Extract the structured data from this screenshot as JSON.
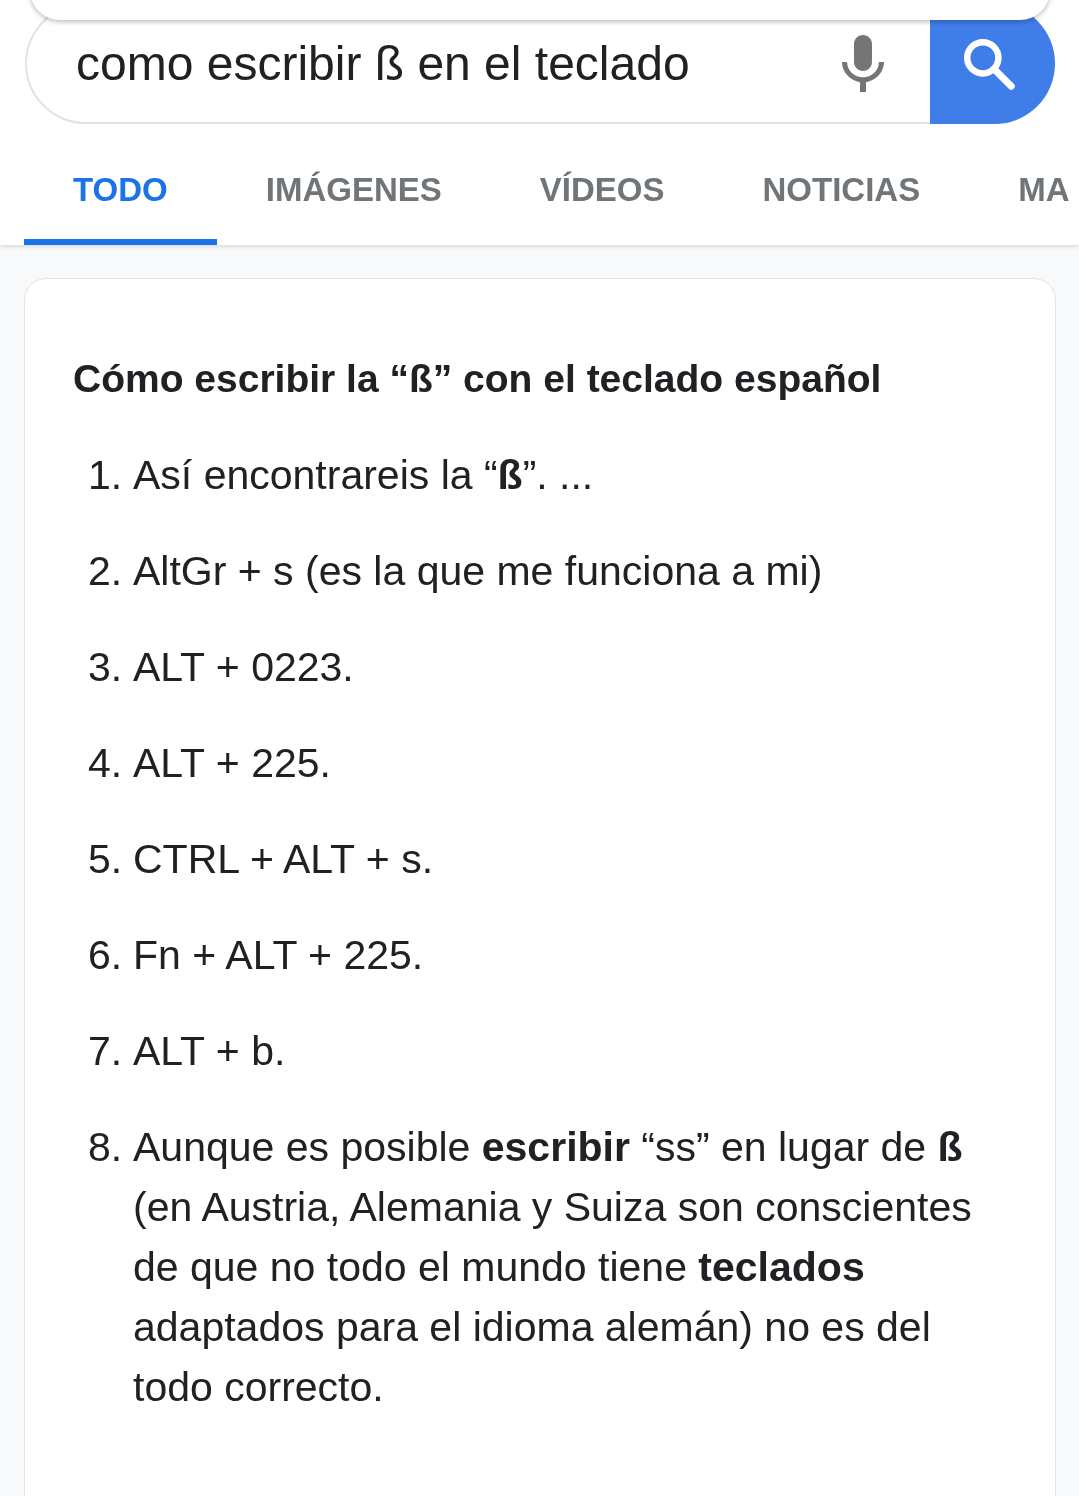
{
  "search": {
    "value": "como escribir ß en el teclado"
  },
  "tabs": [
    {
      "label": "TODO",
      "selected": true
    },
    {
      "label": "IMÁGENES",
      "selected": false
    },
    {
      "label": "VÍDEOS",
      "selected": false
    },
    {
      "label": "NOTICIAS",
      "selected": false
    },
    {
      "label": "MA",
      "selected": false
    }
  ],
  "result_card": {
    "title": "Cómo escribir la “ß” con el teclado español",
    "steps": [
      {
        "number": "1.",
        "text": "Así encontrareis la “**ß**”. ..."
      },
      {
        "number": "2.",
        "text": "AltGr + s (es la que me funciona a mi)"
      },
      {
        "number": "3.",
        "text": "ALT + 0223."
      },
      {
        "number": "4.",
        "text": "ALT + 225."
      },
      {
        "number": "5.",
        "text": "CTRL + ALT + s."
      },
      {
        "number": "6.",
        "text": "Fn + ALT + 225."
      },
      {
        "number": "7.",
        "text": "ALT + b."
      },
      {
        "number": "8.",
        "text": "Aunque es posible **escribir** “ss” en lugar de **ß** (en Austria, Alemania y Suiza son conscientes de que no todo el mundo tiene **teclados** adaptados para el idioma alemán) no es del todo correcto."
      }
    ]
  }
}
